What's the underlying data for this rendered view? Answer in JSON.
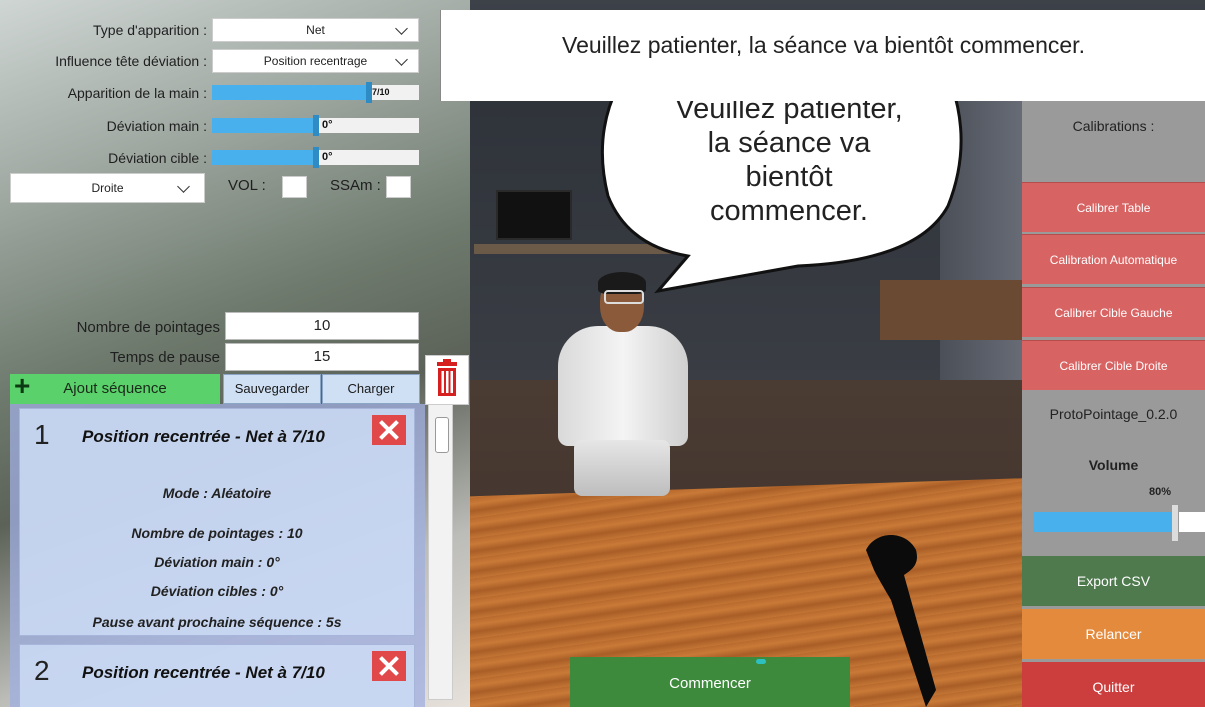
{
  "banner": {
    "message": "Veuillez patienter, la séance va bientôt commencer."
  },
  "bubble": {
    "lines": [
      "Veuillez patienter,",
      "la séance va",
      "bientôt",
      "commencer."
    ]
  },
  "settings": {
    "type_apparition_label": "Type d'apparition :",
    "type_apparition_value": "Net",
    "influence_label": "Influence tête déviation :",
    "influence_value": "Position recentrage",
    "apparition_main_label": "Apparition de la main :",
    "apparition_main_value": "7/10",
    "apparition_main_fraction": 0.7,
    "deviation_main_label": "Déviation main :",
    "deviation_main_value": "0°",
    "deviation_cible_label": "Déviation cible :",
    "deviation_cible_value": "0°",
    "side_value": "Droite",
    "vol_label": "VOL :",
    "ssam_label": "SSAm :",
    "nb_pointages_label": "Nombre de pointages",
    "nb_pointages_value": "10",
    "temps_pause_label": "Temps de pause",
    "temps_pause_value": "15"
  },
  "actions": {
    "add_sequence": "Ajout séquence",
    "save": "Sauvegarder",
    "load": "Charger"
  },
  "sequences": [
    {
      "number": "1",
      "title": "Position recentrée - Net à 7/10",
      "mode": "Mode : Aléatoire",
      "nb_pointages": "Nombre de pointages : 10",
      "deviation_main": "Déviation main : 0°",
      "deviation_cibles": "Déviation cibles : 0°",
      "pause": "Pause avant prochaine séquence : 5s"
    },
    {
      "number": "2",
      "title": "Position recentrée - Net à 7/10"
    }
  ],
  "right_panel": {
    "calibrations_label": "Calibrations :",
    "calibrer_table": "Calibrer Table",
    "calibration_auto": "Calibration Automatique",
    "calibrer_gauche": "Calibrer Cible Gauche",
    "calibrer_droite": "Calibrer Cible Droite",
    "version": "ProtoPointage_0.2.0",
    "volume_label": "Volume",
    "volume_value": "80%",
    "volume_fraction": 0.8,
    "export_csv": "Export CSV",
    "relancer": "Relancer",
    "quitter": "Quitter"
  },
  "start_button": "Commencer",
  "colors": {
    "slider_fill": "#49b0ee",
    "add_button": "#5bd16b",
    "calibrate_button": "#d86363",
    "export_button": "#4e7a4e",
    "relancer_button": "#e48a3c",
    "quitter_button": "#cc3d3d",
    "start_button": "#3d8a3d"
  }
}
